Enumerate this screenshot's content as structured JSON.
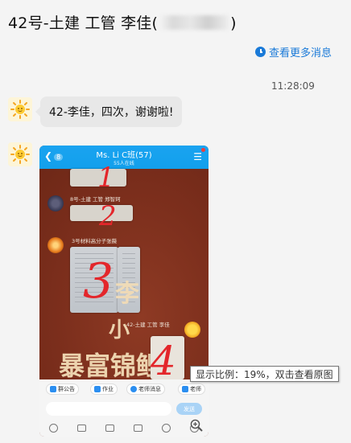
{
  "header": {
    "title_prefix": "42号-土建 工管 李佳(",
    "title_suffix": ")"
  },
  "chat": {
    "more_messages_label": "查看更多消息",
    "timestamp": "11:28:09",
    "message_text": "42-李佳，四次，谢谢啦!"
  },
  "image_message": {
    "group_title": "Ms. Li C班(57)",
    "group_subtitle": "55人在线",
    "back_badge": "8",
    "sender_1_name": "8号-土建 工管 郑智珂",
    "sender_2_name": "3号材料高分子张薇",
    "sender_3_name": "42-土建 工管 李佳",
    "scribble_numbers": [
      "1",
      "2",
      "3",
      "4"
    ],
    "decor_text_1": "李",
    "decor_text_2": "小",
    "decor_text_3": "暴富锦鲤",
    "toolbar_chips": [
      "群公告",
      "作业",
      "老师消息",
      "老师"
    ],
    "send_label": "发送"
  },
  "tooltip": {
    "text": "显示比例：19%，双击查看原图"
  },
  "colors": {
    "accent": "#1a7ad8",
    "bubble_bg": "#e8e8e8",
    "scribble": "#e3262b"
  }
}
